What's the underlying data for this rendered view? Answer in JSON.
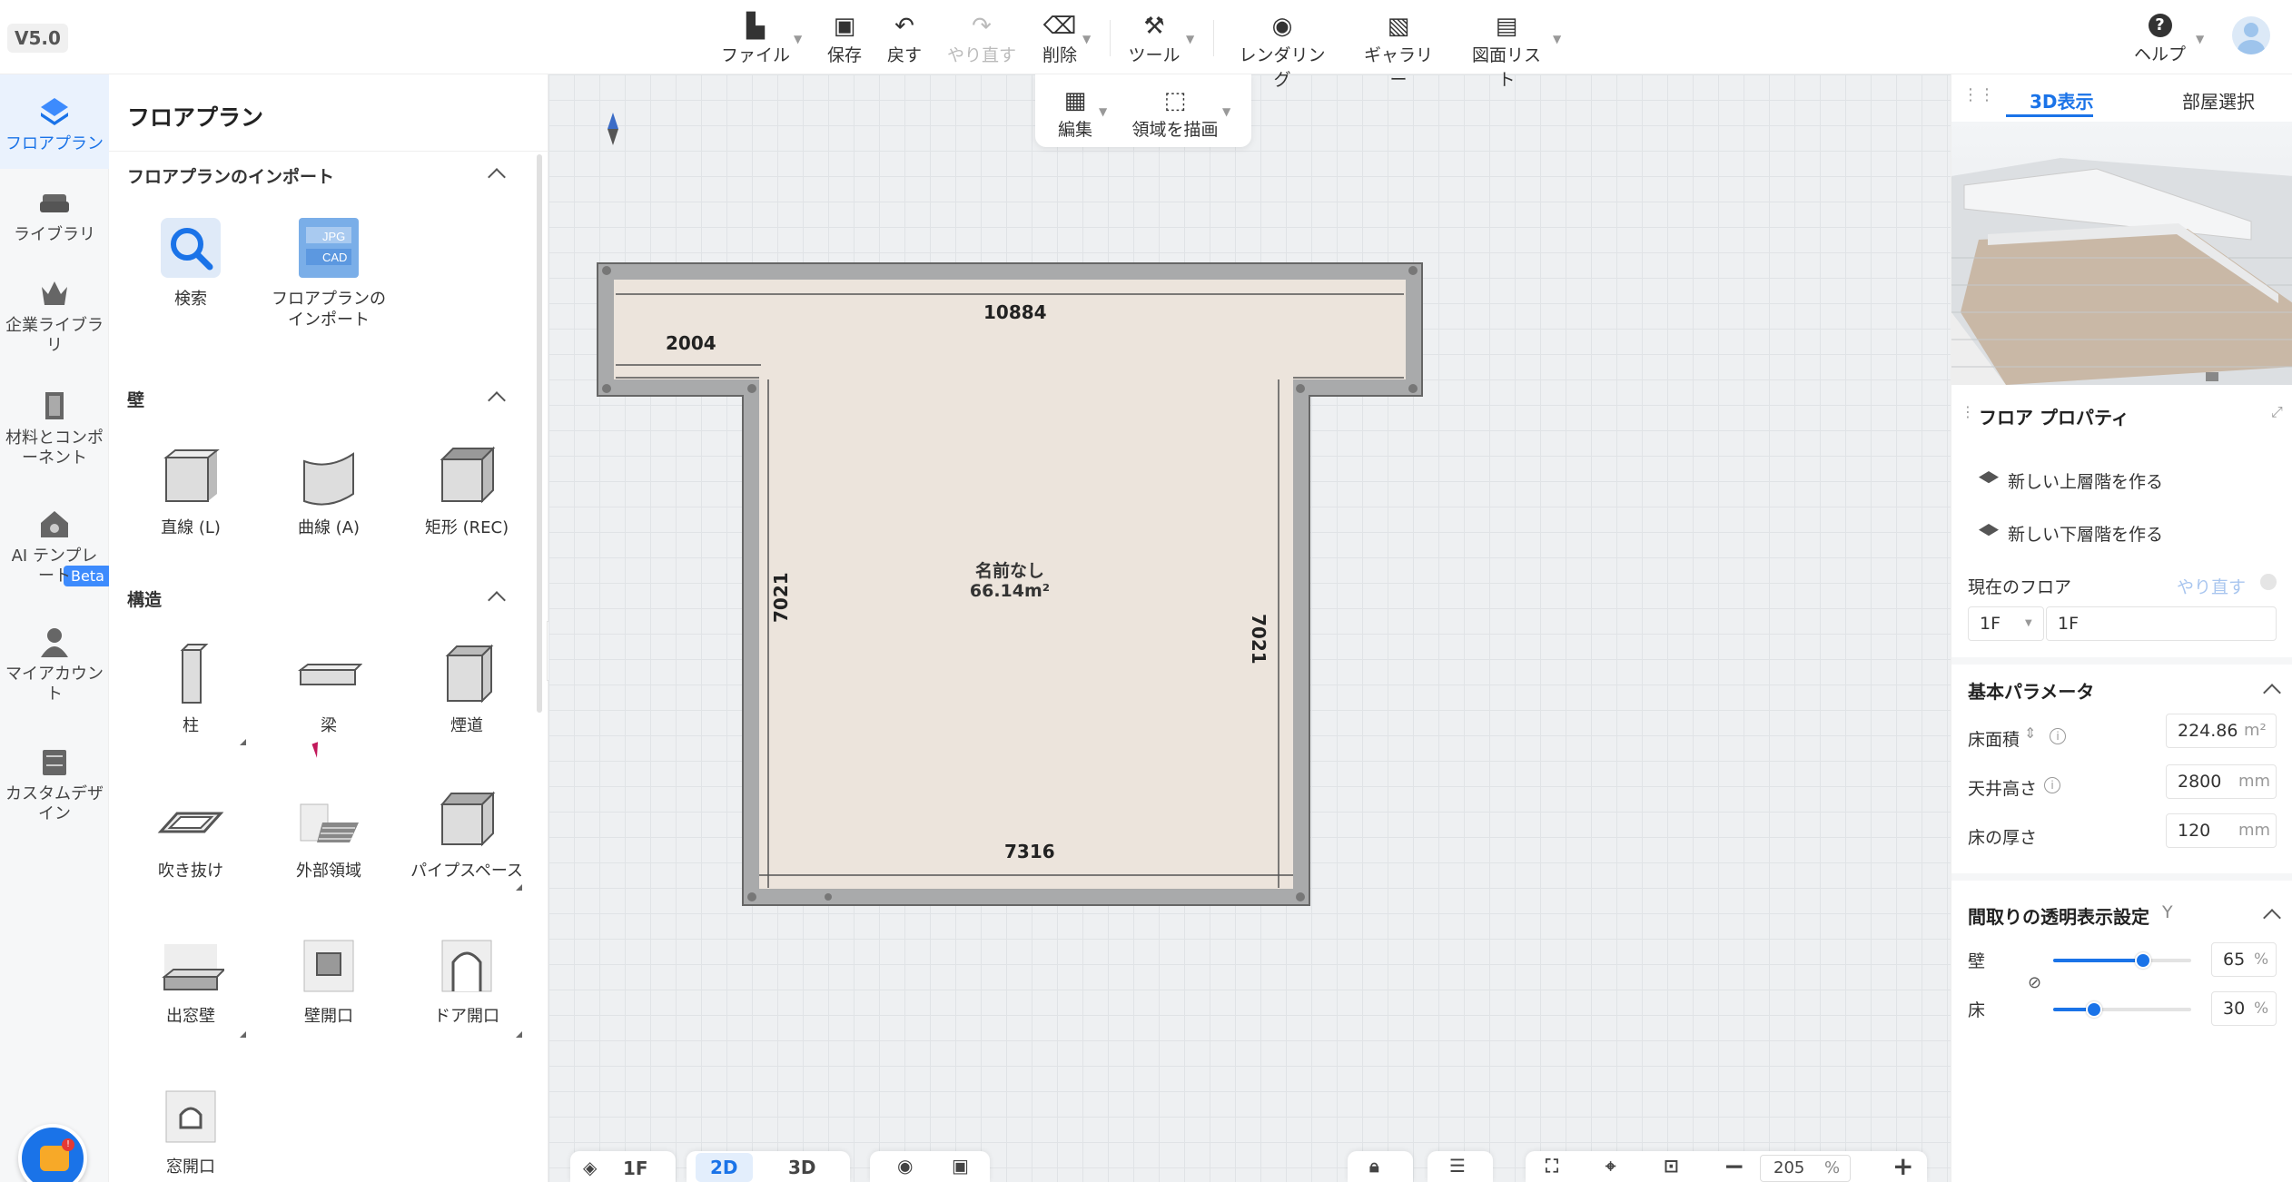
{
  "app": {
    "version": "V5.0"
  },
  "toolbar": {
    "file": "ファイル",
    "save": "保存",
    "undo": "戻す",
    "redo": "やり直す",
    "delete": "削除",
    "tools": "ツール",
    "render": "レンダリング",
    "gallery": "ギャラリー",
    "drawing_list": "図面リスト",
    "help": "ヘルプ"
  },
  "subtoolbar": {
    "edit": "編集",
    "draw_area": "領域を描画"
  },
  "leftnav": {
    "items": [
      "フロアプラン",
      "ライブラリ",
      "企業ライブラリ",
      "材料とコンポーネント",
      "AI テンプレート",
      "マイアカウント",
      "カスタムデザイン"
    ],
    "beta": "Beta"
  },
  "panel": {
    "title": "フロアプラン",
    "import_section": "フロアプランのインポート",
    "import_items": [
      "検索",
      "フロアプランのインポート"
    ],
    "wall_section": "壁",
    "wall_items": [
      "直線 (L)",
      "曲線 (A)",
      "矩形 (REC)"
    ],
    "structure_section": "構造",
    "structure_items": [
      "柱",
      "梁",
      "煙道",
      "吹き抜け",
      "外部領域",
      "パイプスペース",
      "出窓壁",
      "壁開口",
      "ドア開口",
      "窓開口"
    ],
    "icon_labels": {
      "jpg": "JPG",
      "cad": "CAD"
    }
  },
  "canvas": {
    "dims": {
      "top_width": "10884",
      "left_wing": "2004",
      "left_height": "7021",
      "right_height": "7021",
      "bottom_width": "7316"
    },
    "room_name": "名前なし",
    "room_area": "66.14m²"
  },
  "bottombar": {
    "floor": "1F",
    "mode2d": "2D",
    "mode3d": "3D",
    "zoom": "205",
    "zoom_unit": "%"
  },
  "rightpanel": {
    "tabs": [
      "3D表示",
      "部屋選択"
    ],
    "title": "フロア プロパティ",
    "add_upper": "新しい上層階を作る",
    "add_lower": "新しい下層階を作る",
    "current_floor_label": "現在のフロア",
    "current_floor_redo": "やり直す",
    "floor_select": "1F",
    "floor_name": "1F",
    "basic_params": "基本パラメータ",
    "floor_area_label": "床面積",
    "floor_area_value": "224.86",
    "floor_area_unit": "m²",
    "ceiling_label": "天井高さ",
    "ceiling_value": "2800",
    "ceiling_unit": "mm",
    "thickness_label": "床の厚さ",
    "thickness_value": "120",
    "thickness_unit": "mm",
    "transparency_title": "間取りの透明表示設定",
    "transparency_key": "Y",
    "wall_label": "壁",
    "wall_value": "65",
    "floor_label": "床",
    "floor_value": "30",
    "percent": "%"
  },
  "colors": {
    "accent": "#1a73e8",
    "wall": "#a9aaab",
    "floor": "#ece4dc"
  }
}
